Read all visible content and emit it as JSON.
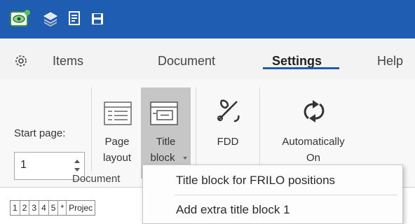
{
  "quick_access": {
    "icons": [
      "app-logo-icon",
      "layers-icon",
      "document-icon",
      "save-icon"
    ]
  },
  "tabs": [
    {
      "label": "Items",
      "active": false
    },
    {
      "label": "Document",
      "active": false
    },
    {
      "label": "Settings",
      "active": true
    },
    {
      "label": "Help",
      "active": false
    }
  ],
  "settings_icon": "gear-icon",
  "ribbon": {
    "start_page_label": "Start page:",
    "start_page_value": "1",
    "page_layout": {
      "line1": "Page",
      "line2": "layout"
    },
    "title_block": {
      "line1": "Title",
      "line2": "block"
    },
    "fdd": {
      "label": "FDD"
    },
    "auto": {
      "line1": "Automatically",
      "line2": "On"
    },
    "group_label": "Document"
  },
  "dropdown": {
    "items": [
      {
        "label": "Title block for FRILO positions"
      },
      {
        "label": "Add extra title block 1"
      }
    ]
  },
  "table_header": {
    "cells": [
      "1",
      "2",
      "3",
      "4",
      "5",
      "*",
      "Projec"
    ]
  },
  "colors": {
    "titlebar": "#1f5db3",
    "active_tab_underline": "#1f5db3",
    "selected_button": "#c6c6c6"
  }
}
